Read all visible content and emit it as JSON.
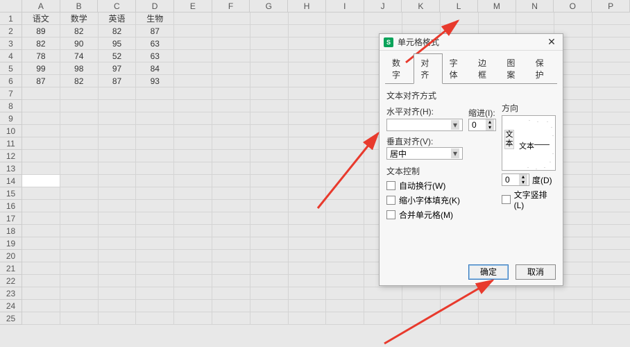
{
  "sheet": {
    "columns": [
      "A",
      "B",
      "C",
      "D",
      "E",
      "F",
      "G",
      "H",
      "I",
      "J",
      "K",
      "L",
      "M",
      "N",
      "O",
      "P"
    ],
    "rowCount": 25,
    "headerRow": [
      "语文",
      "数学",
      "英语",
      "生物"
    ],
    "data": [
      [
        "89",
        "82",
        "82",
        "87"
      ],
      [
        "82",
        "90",
        "95",
        "63"
      ],
      [
        "78",
        "74",
        "52",
        "63"
      ],
      [
        "99",
        "98",
        "97",
        "84"
      ],
      [
        "87",
        "82",
        "87",
        "93"
      ]
    ],
    "selectedCell": {
      "row": 14,
      "col": "A"
    }
  },
  "dialog": {
    "title": "单元格格式",
    "tabs": [
      "数字",
      "对齐",
      "字体",
      "边框",
      "图案",
      "保护"
    ],
    "activeTab": 1,
    "alignSection": "文本对齐方式",
    "hAlignLabel": "水平对齐(H):",
    "hAlignValue": "",
    "indentLabel": "缩进(I):",
    "indentValue": "0",
    "vAlignLabel": "垂直对齐(V):",
    "vAlignValue": "居中",
    "textControlSection": "文本控制",
    "wrapText": "自动换行(W)",
    "shrinkFit": "缩小字体填充(K)",
    "mergeCells": "合并单元格(M)",
    "directionLabel": "方向",
    "dirVertText": "文本",
    "dirHorizText": "文本",
    "degreeValue": "0",
    "degreeLabel": "度(D)",
    "verticalTextLabel": "文字竖排(L)",
    "ok": "确定",
    "cancel": "取消"
  }
}
